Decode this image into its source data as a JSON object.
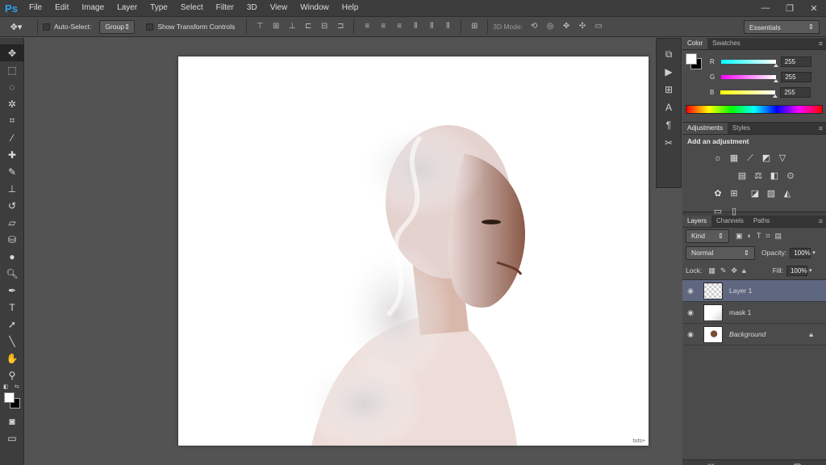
{
  "app": {
    "logo": "Ps"
  },
  "menu": [
    "File",
    "Edit",
    "Image",
    "Layer",
    "Type",
    "Select",
    "Filter",
    "3D",
    "View",
    "Window",
    "Help"
  ],
  "window_controls": {
    "minimize": "—",
    "restore": "❐",
    "close": "✕"
  },
  "options": {
    "auto_select_label": "Auto-Select:",
    "auto_select_value": "Group",
    "show_transform_label": "Show Transform Controls",
    "mode3d_label": "3D Mode:",
    "workspace": "Essentials"
  },
  "color_panel": {
    "tabs": [
      "Color",
      "Swatches"
    ],
    "sliders": [
      {
        "label": "R",
        "value": "255",
        "color": "#00d0e0"
      },
      {
        "label": "G",
        "value": "255",
        "color": "#e040d0"
      },
      {
        "label": "B",
        "value": "255",
        "color": "#f0f000"
      }
    ]
  },
  "adjustments_panel": {
    "tabs": [
      "Adjustments",
      "Styles"
    ],
    "heading": "Add an adjustment"
  },
  "layers_panel": {
    "tabs": [
      "Layers",
      "Channels",
      "Paths"
    ],
    "kind_filter": "Kind",
    "blend_mode": "Normal",
    "opacity_label": "Opacity:",
    "opacity_value": "100%",
    "lock_label": "Lock:",
    "fill_label": "Fill:",
    "fill_value": "100%",
    "layers": [
      {
        "name": "Layer 1",
        "selected": true
      },
      {
        "name": "mask 1",
        "selected": false
      },
      {
        "name": "Background",
        "selected": false
      }
    ]
  },
  "watermark": "tuts+"
}
